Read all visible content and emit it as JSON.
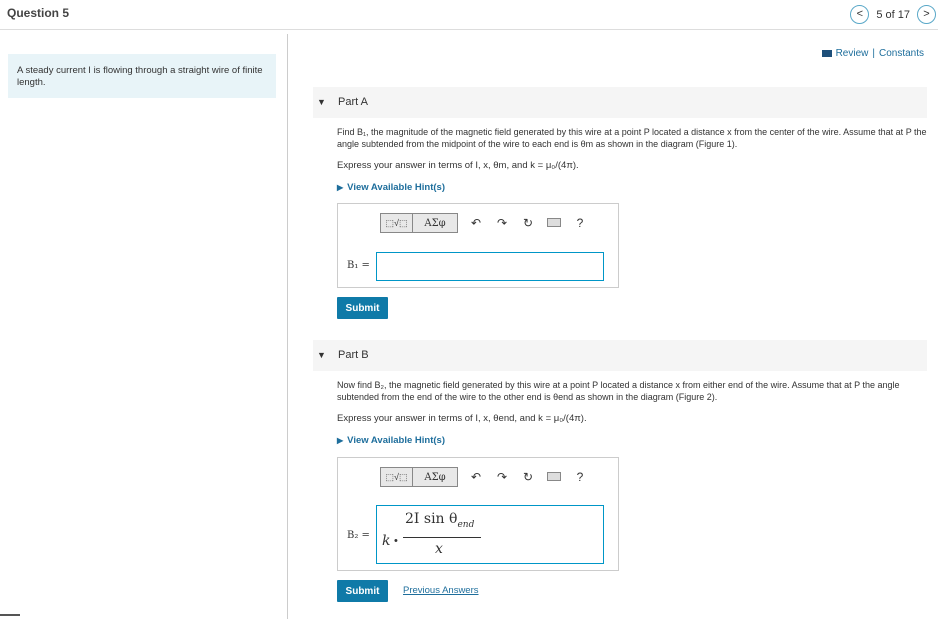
{
  "header": {
    "question_title": "Question 5",
    "prev_label": "<",
    "next_label": ">",
    "counter": "5 of 17"
  },
  "left_panel": {
    "text": "A steady current I is flowing through a straight wire of finite length."
  },
  "review": {
    "review_label": "Review",
    "separator": "|",
    "constants_label": "Constants"
  },
  "part_a": {
    "title": "Part A",
    "description": "Find B₁, the magnitude of the magnetic field generated by this wire at a point P located a distance x from the center of the wire. Assume that at P the angle subtended from the midpoint of the wire to each end is θm as shown in the diagram (Figure 1).",
    "express": "Express your answer in terms of I, x, θm, and k = μ₀/(4π).",
    "hint": "View Available Hint(s)",
    "answer_label": "B₁ =",
    "answer_value": "",
    "submit_label": "Submit"
  },
  "part_b": {
    "title": "Part B",
    "description": "Now find B₂, the magnetic field generated by this wire at a point P located a distance x from either end of the wire. Assume that at P the angle subtended from the end of the wire to the other end is θend as shown in the diagram (Figure 2).",
    "express": "Express your answer in terms of I, x, θend, and k = μ₀/(4π).",
    "hint": "View Available Hint(s)",
    "answer_label": "B₂ =",
    "answer_k": "k",
    "answer_dot": "•",
    "answer_numerator": "2I sin θ",
    "answer_numerator_sub": "end",
    "answer_denominator": "x",
    "submit_label": "Submit",
    "previous_answers": "Previous Answers"
  },
  "toolbar": {
    "templates_label": "⬚√⬚",
    "symbols_label": "ΑΣφ",
    "undo_icon": "undo-icon",
    "redo_icon": "redo-icon",
    "reset_icon": "reset-icon",
    "keyboard_icon": "keyboard-icon",
    "help_label": "?"
  },
  "colors": {
    "accent": "#1e6e9c",
    "submit": "#0f7aa8",
    "panel_bg": "#e8f4f8",
    "header_bg": "#f5f5f5"
  }
}
